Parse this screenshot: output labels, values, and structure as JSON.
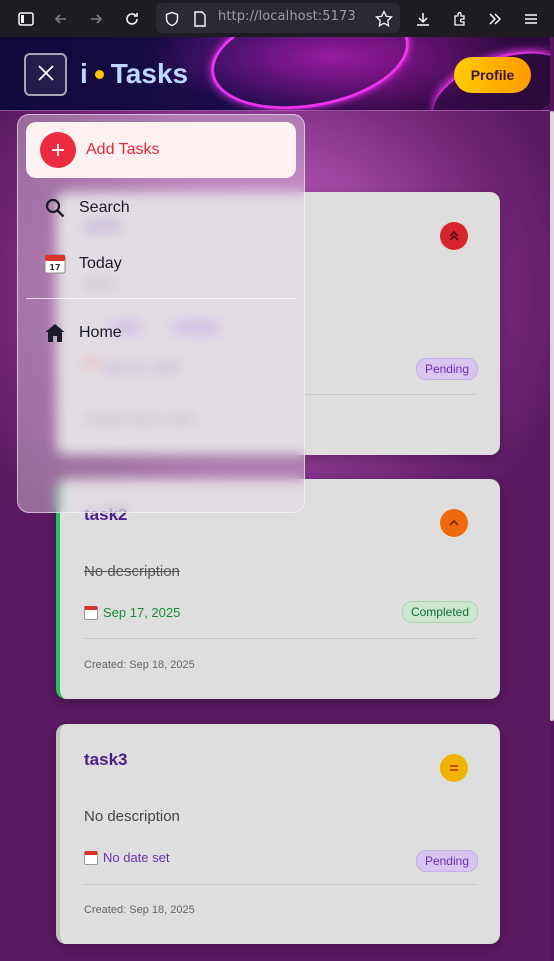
{
  "browser": {
    "url_host": "http://localhost",
    "url_port": ":5173"
  },
  "header": {
    "logo_i": "i",
    "logo_text": "Tasks",
    "profile_label": "Profile"
  },
  "menu": {
    "add_label": "Add Tasks",
    "items": [
      {
        "label": "Search",
        "icon": "search-icon"
      },
      {
        "label": "Today",
        "icon": "calendar-icon"
      },
      {
        "label": "Home",
        "icon": "home-icon"
      }
    ]
  },
  "tasks": [
    {
      "title": "task1",
      "description": "task1...",
      "tags": [
        "work",
        "meeting"
      ],
      "due": "Sep 16, 2025",
      "status": "Pending",
      "created": "Created: Sep 18, 2025",
      "priority": "high",
      "priority_color": "#d9232f"
    },
    {
      "title": "task2",
      "description": "No description",
      "due": "Sep 17, 2025",
      "status": "Completed",
      "created": "Created: Sep 18, 2025",
      "priority": "medium",
      "priority_color": "#ee6a0c"
    },
    {
      "title": "task3",
      "description": "No description",
      "due": "No date set",
      "status": "Pending",
      "created": "Created: Sep 18, 2025",
      "priority": "low",
      "priority_color": "#f0b400"
    }
  ],
  "colors": {
    "accent": "#4a1d8a",
    "add_red": "#ec2a40",
    "profile_gradient_start": "#ffcc00",
    "profile_gradient_end": "#ff9a00"
  }
}
